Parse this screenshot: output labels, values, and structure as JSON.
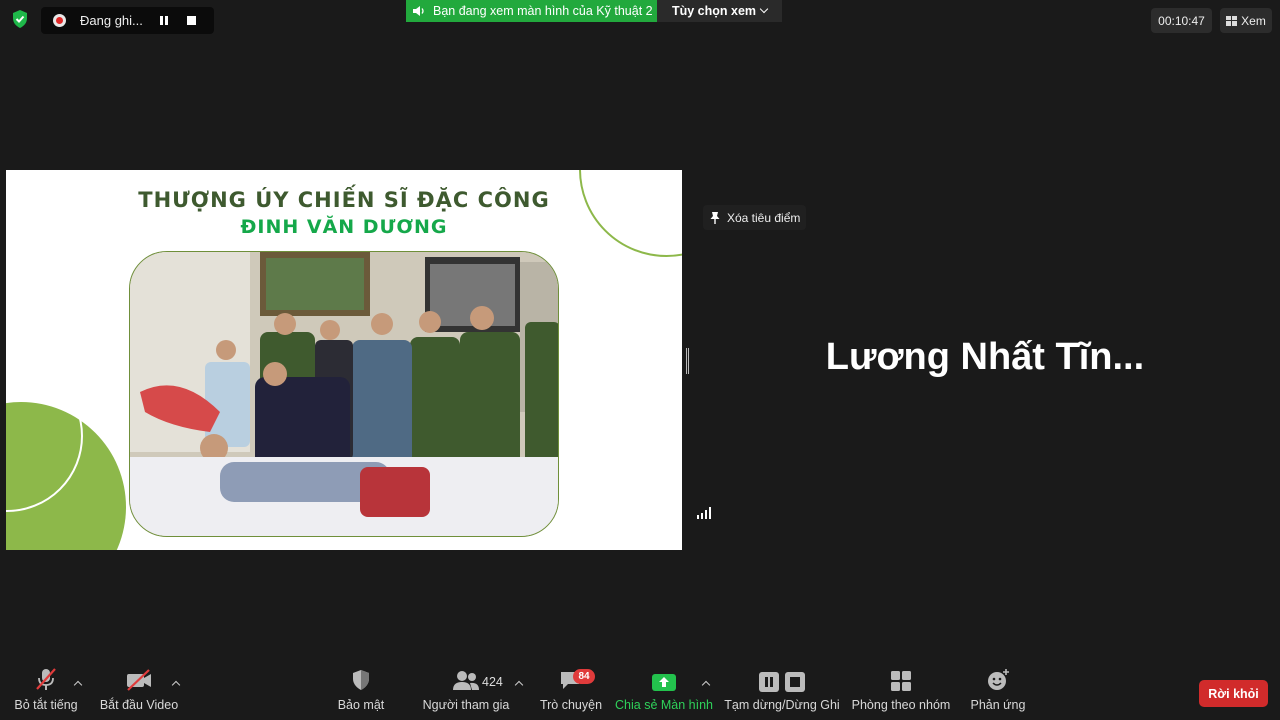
{
  "top": {
    "recording_label": "Đang ghi...",
    "viewing_banner": "Bạn đang xem màn hình của Kỹ thuật 2",
    "view_options": "Tùy chọn xem",
    "timer": "00:10:47",
    "view_button": "Xem"
  },
  "slide": {
    "title_line1": "THƯỢNG ÚY CHIẾN SĨ ĐẶC CÔNG",
    "title_line2": "ĐINH VĂN DƯƠNG"
  },
  "spotlight": {
    "unpin_label": "Xóa tiêu điểm",
    "speaker_name": "Lương Nhất Tĩn..."
  },
  "toolbar": {
    "mute": "Bỏ tắt tiếng",
    "video": "Bắt đầu Video",
    "security": "Bảo mật",
    "participants": "Người tham gia",
    "participants_count": "424",
    "chat": "Trò chuyện",
    "chat_badge": "84",
    "share": "Chia sẻ Màn hình",
    "record": "Tạm dừng/Dừng Ghi",
    "breakout": "Phòng theo nhóm",
    "reactions": "Phản ứng",
    "leave": "Rời khỏi"
  },
  "colors": {
    "accent_green": "#22a93d",
    "leave_red": "#d12b2b",
    "slide_green": "#8db84a"
  }
}
